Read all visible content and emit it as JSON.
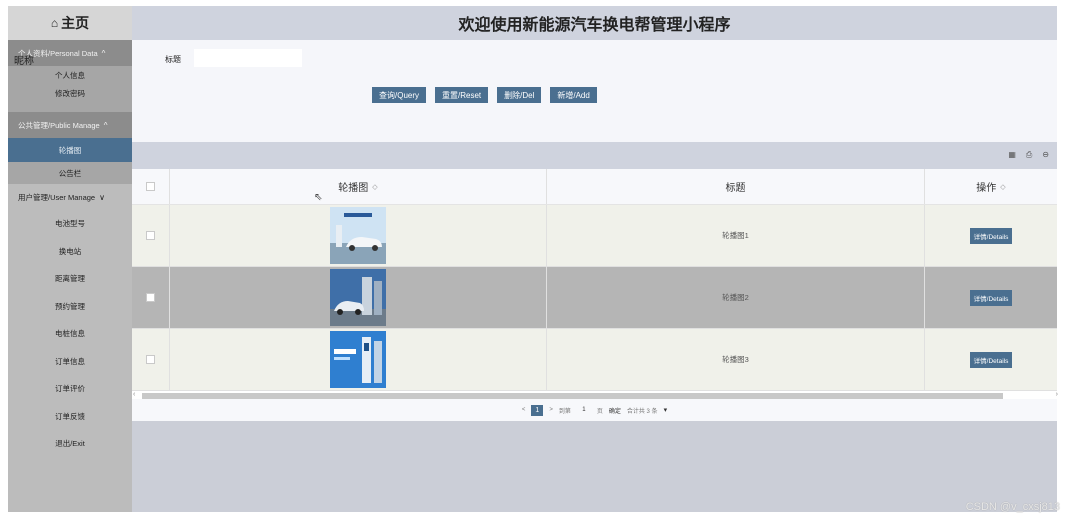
{
  "sidebar": {
    "home_icon": "⌂",
    "home_label": "主页",
    "overlap_text": "昵称",
    "group1_label": "个人资料/Personal Data",
    "group1_items": [
      "个人信息",
      "修改密码"
    ],
    "group2_label": "公共管理/Public Manage",
    "group2_items": [
      "轮播图",
      "公告栏"
    ],
    "group3_label": "用户管理/User Manage",
    "items": [
      "电池型号",
      "换电站",
      "距离管理",
      "预约管理",
      "电桩信息",
      "订单信息",
      "订单评价",
      "订单反馈",
      "退出/Exit"
    ],
    "chevron_up": "^",
    "chevron_down": "∨"
  },
  "header": {
    "title": "欢迎使用新能源汽车换电帮管理小程序"
  },
  "search": {
    "label": "标题",
    "value": "",
    "buttons": {
      "query": "查询/Query",
      "reset": "重置/Reset",
      "delete": "删除/Del",
      "add": "新增/Add"
    }
  },
  "toolbar_icons": [
    "grid-icon",
    "print-icon",
    "export-icon"
  ],
  "table": {
    "headers": {
      "image": "轮播图",
      "title": "标题",
      "op": "操作"
    },
    "sort_icon": "◇",
    "rows": [
      {
        "title": "轮播图1",
        "detail": "详情/Details"
      },
      {
        "title": "轮播图2",
        "detail": "详情/Details"
      },
      {
        "title": "轮播图3",
        "detail": "详情/Details"
      }
    ]
  },
  "pagination": {
    "prev": "<",
    "current": "1",
    "next": ">",
    "goto_label": "到第",
    "goto_value": "1",
    "page_unit": "页",
    "confirm": "确定",
    "total": "合计共 3 条",
    "select_arrow": "▾"
  },
  "watermark": "CSDN @v_cxsj813",
  "colors": {
    "accent": "#4a6f90",
    "sidebar": "#bcbcbc",
    "header": "#cfd3de"
  }
}
